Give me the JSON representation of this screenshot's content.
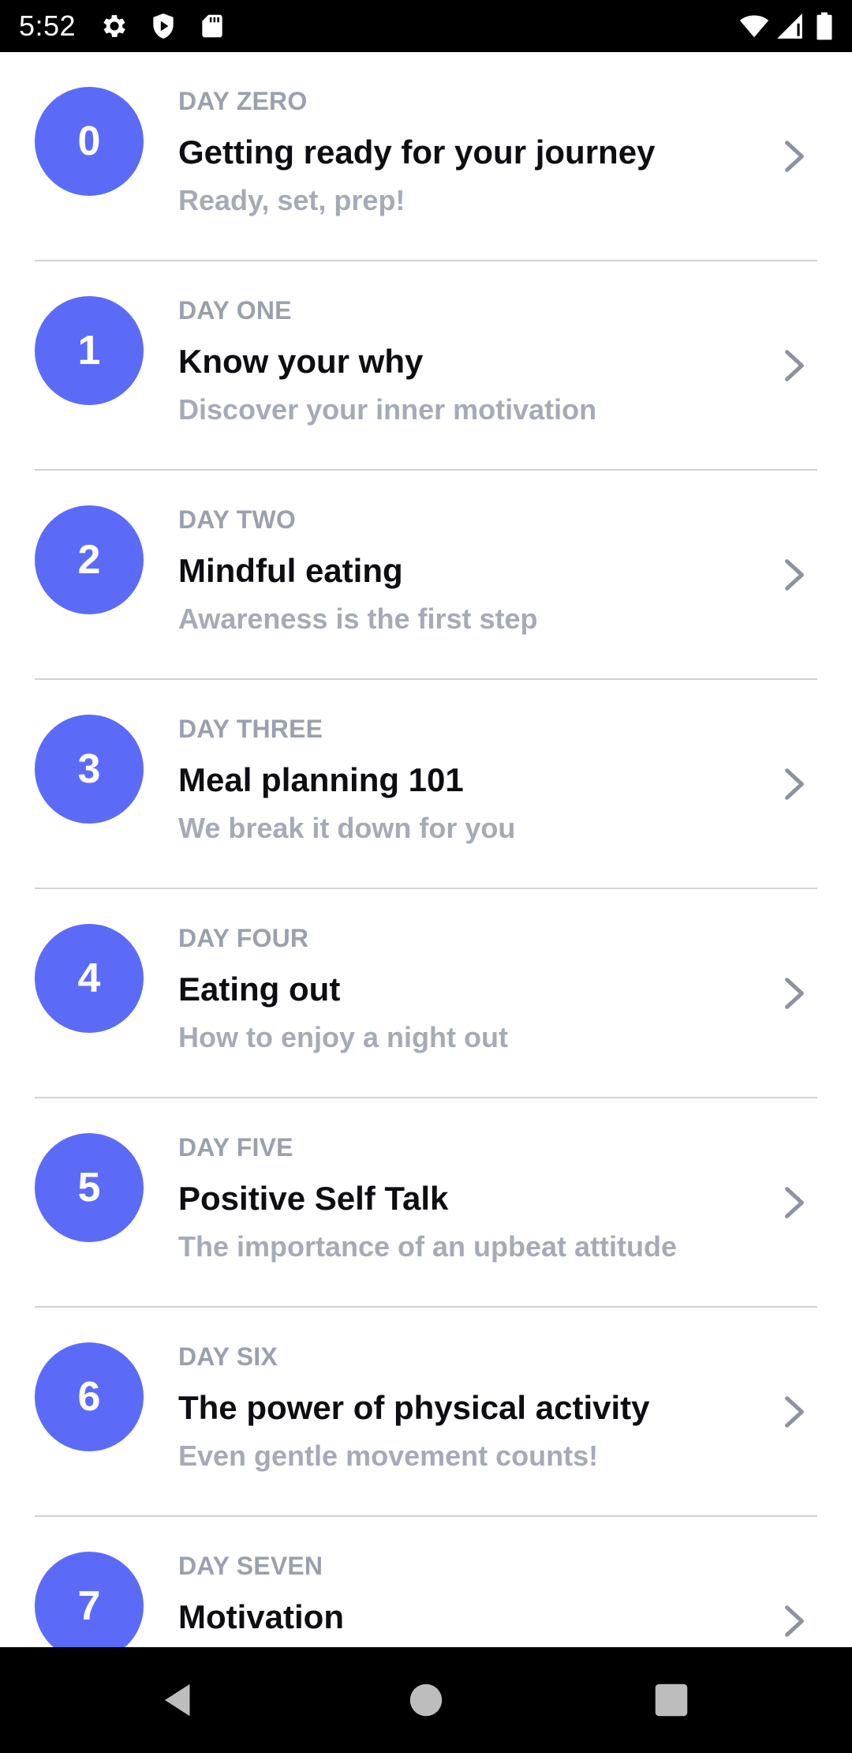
{
  "status_bar": {
    "time": "5:52",
    "left_icons": [
      "settings-icon",
      "shield-icon",
      "sd-card-icon"
    ],
    "right_icons": [
      "wifi-icon",
      "cellular-signal-icon",
      "battery-icon"
    ]
  },
  "colors": {
    "badge": "#5c6bf7",
    "title": "#0d0d12",
    "muted": "#9aa1ad",
    "divider": "#cfd3d9"
  },
  "days": [
    {
      "number": "0",
      "label": "DAY ZERO",
      "title": "Getting ready for your journey",
      "subtitle": "Ready, set, prep!"
    },
    {
      "number": "1",
      "label": "DAY ONE",
      "title": "Know your why",
      "subtitle": "Discover your inner motivation"
    },
    {
      "number": "2",
      "label": "DAY TWO",
      "title": "Mindful eating",
      "subtitle": "Awareness is the first step"
    },
    {
      "number": "3",
      "label": "DAY THREE",
      "title": "Meal planning 101",
      "subtitle": "We break it down for you"
    },
    {
      "number": "4",
      "label": "DAY FOUR",
      "title": "Eating out",
      "subtitle": "How to enjoy a night out"
    },
    {
      "number": "5",
      "label": "DAY FIVE",
      "title": "Positive Self Talk",
      "subtitle": "The importance of an upbeat attitude"
    },
    {
      "number": "6",
      "label": "DAY SIX",
      "title": "The power of physical activity",
      "subtitle": "Even gentle movement counts!"
    },
    {
      "number": "7",
      "label": "DAY SEVEN",
      "title": "Motivation",
      "subtitle": ""
    }
  ],
  "nav_bar": {
    "buttons": [
      "back-icon",
      "home-icon",
      "recents-icon"
    ]
  }
}
